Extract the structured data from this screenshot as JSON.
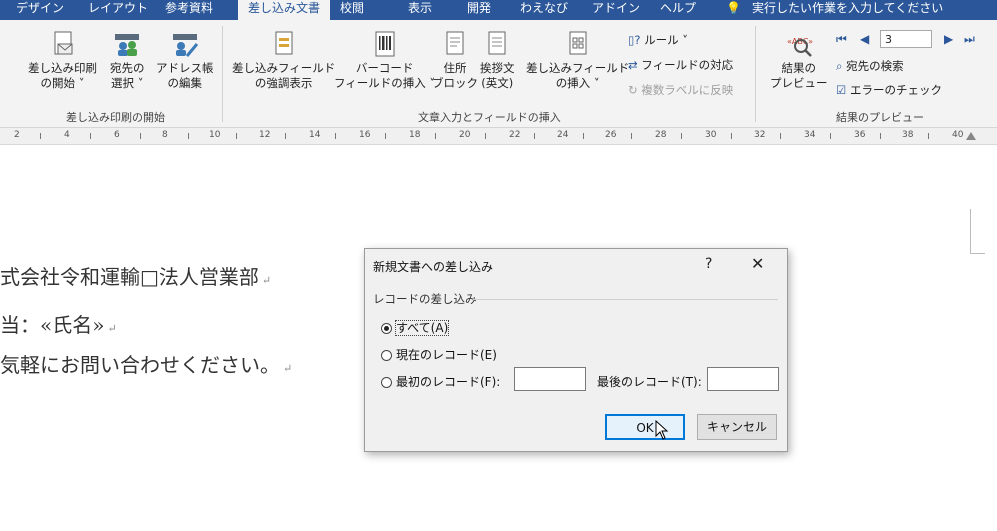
{
  "ribbon_tabs": [
    "デザイン",
    "レイアウト",
    "参考資料",
    "差し込み文書",
    "校閲",
    "表示",
    "開発",
    "わえなび",
    "アドイン",
    "ヘルプ"
  ],
  "active_tab": "差し込み文書",
  "tell_me": "実行したい作業を入力してください",
  "groups": {
    "start": {
      "label": "差し込み印刷の開始",
      "buttons": [
        {
          "line1": "差し込み印刷",
          "line2": "の開始 ˅"
        },
        {
          "line1": "宛先の",
          "line2": "選択 ˅"
        },
        {
          "line1": "アドレス帳",
          "line2": "の編集"
        }
      ]
    },
    "write": {
      "label": "文章入力とフィールドの挿入",
      "buttons": [
        {
          "line1": "差し込みフィールド",
          "line2": "の強調表示"
        },
        {
          "line1": "バーコード",
          "line2": "フィールドの挿入 ˅"
        },
        {
          "line1": "住所",
          "line2": "ブロック"
        },
        {
          "line1": "挨拶文",
          "line2": "(英文)"
        },
        {
          "line1": "差し込みフィールド",
          "line2": "の挿入 ˅"
        }
      ],
      "small": [
        "ルール ˅",
        "フィールドの対応",
        "複数ラベルに反映"
      ]
    },
    "preview": {
      "label": "結果のプレビュー",
      "button": {
        "line1": "結果の",
        "line2": "プレビュー"
      },
      "record": "3",
      "small": [
        "宛先の検索",
        "エラーのチェック"
      ]
    }
  },
  "ruler": [
    "2",
    "4",
    "6",
    "8",
    "10",
    "12",
    "14",
    "16",
    "18",
    "20",
    "22",
    "24",
    "26",
    "28",
    "30",
    "32",
    "34",
    "36",
    "38",
    "40"
  ],
  "doc_lines": [
    "式会社令和運輸□法人営業部",
    "当：«氏名»",
    "気軽にお問い合わせください。"
  ],
  "pilcrow": "↵",
  "dialog": {
    "title": "新規文書への差し込み",
    "help": "?",
    "close": "✕",
    "group": "レコードの差し込み",
    "options": [
      "すべて(A)",
      "現在のレコード(E)",
      "最初のレコード(F):"
    ],
    "last_label": "最後のレコード(T):",
    "first_value": "",
    "last_value": "",
    "ok": "OK",
    "cancel": "キャンセル"
  }
}
